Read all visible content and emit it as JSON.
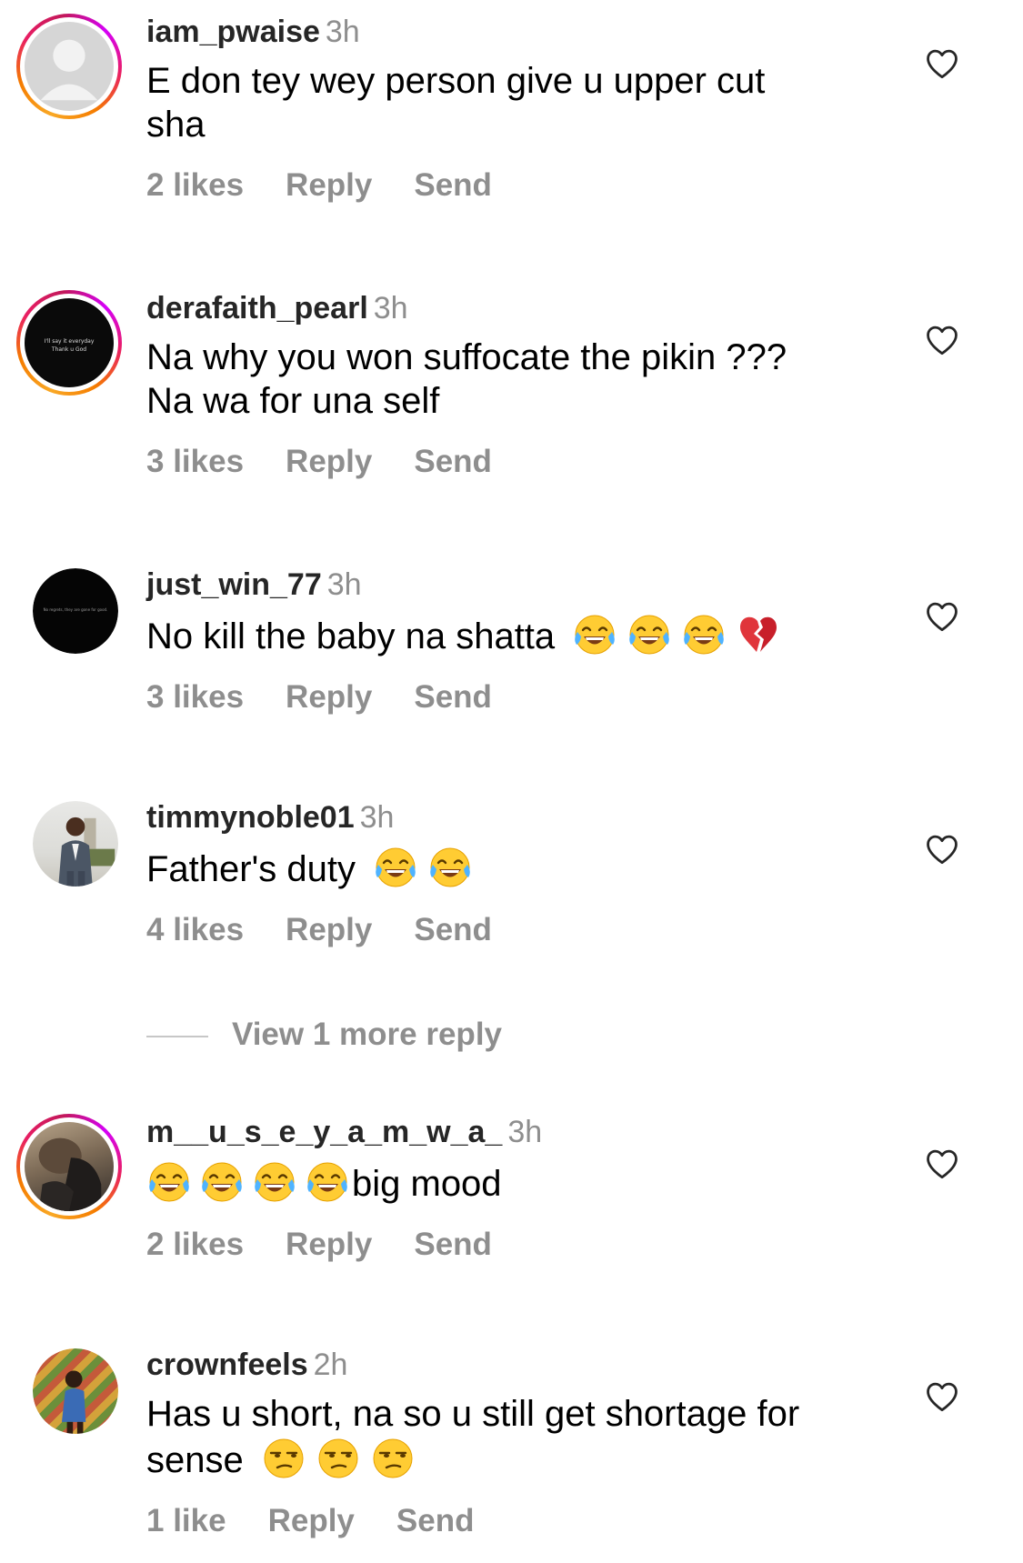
{
  "comments": [
    {
      "username": "iam_pwaise",
      "time": "3h",
      "text_line1": "E don tey wey person give u upper cut",
      "text_line2": "sha",
      "likes": "2 likes",
      "reply": "Reply",
      "send": "Send"
    },
    {
      "username": "derafaith_pearl",
      "time": "3h",
      "text_line1": "Na why you won suffocate the pikin ???",
      "text_line2": "Na wa for una self",
      "likes": "3 likes",
      "reply": "Reply",
      "send": "Send",
      "avatar_text1": "I'll say it everyday",
      "avatar_text2": "Thank u God"
    },
    {
      "username": "just_win_77",
      "time": "3h",
      "text": "No kill the baby na shatta",
      "likes": "3 likes",
      "reply": "Reply",
      "send": "Send",
      "avatar_text": "No regrets, they are gone for good."
    },
    {
      "username": "timmynoble01",
      "time": "3h",
      "text": "Father's duty",
      "likes": "4 likes",
      "reply": "Reply",
      "send": "Send"
    },
    {
      "username": "m__u_s_e_y_a_m_w_a_",
      "time": "3h",
      "text": "big mood",
      "likes": "2 likes",
      "reply": "Reply",
      "send": "Send"
    },
    {
      "username": "crownfeels",
      "time": "2h",
      "text_line1": "Has u short, na so u still get shortage for",
      "text_line2": "sense",
      "likes": "1 like",
      "reply": "Reply",
      "send": "Send"
    }
  ],
  "view_more": "View 1 more reply",
  "icons": {
    "like": "heart-outline-icon",
    "laugh": "face-with-tears-of-joy-emoji",
    "broken_heart": "broken-heart-emoji",
    "unamused": "unamused-face-emoji"
  },
  "colors": {
    "secondary_text": "#8e8e8e",
    "primary_text": "#000000",
    "story_ring_start": "#f9a825",
    "story_ring_end": "#d500f9"
  }
}
